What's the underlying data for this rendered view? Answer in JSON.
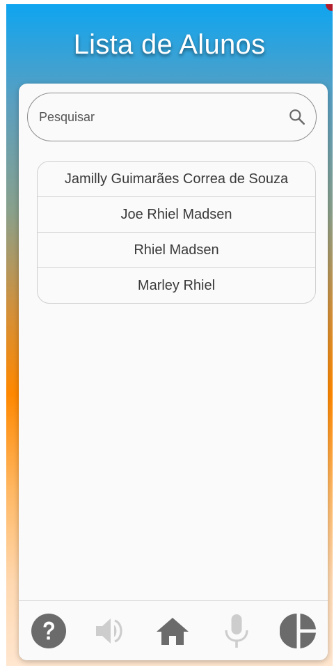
{
  "header": {
    "title": "Lista de Alunos"
  },
  "search": {
    "placeholder": "Pesquisar",
    "icon": "search-icon"
  },
  "students": [
    "Jamilly Guimarães Correa de Souza",
    "Joe Rhiel Madsen",
    "Rhiel Madsen",
    "Marley Rhiel"
  ],
  "bottom_nav": [
    {
      "icon": "help-icon",
      "active": true
    },
    {
      "icon": "volume-icon",
      "active": false
    },
    {
      "icon": "home-icon",
      "active": true
    },
    {
      "icon": "microphone-icon",
      "active": false
    },
    {
      "icon": "pie-chart-icon",
      "active": true
    }
  ],
  "colors": {
    "gradient_top": "#0fa5f0",
    "gradient_middle": "#ff8800",
    "gradient_bottom": "#ffe6cf",
    "icon_active": "#6b6b6b",
    "icon_inactive": "#cdcdcd",
    "card_background": "#fafafa"
  }
}
